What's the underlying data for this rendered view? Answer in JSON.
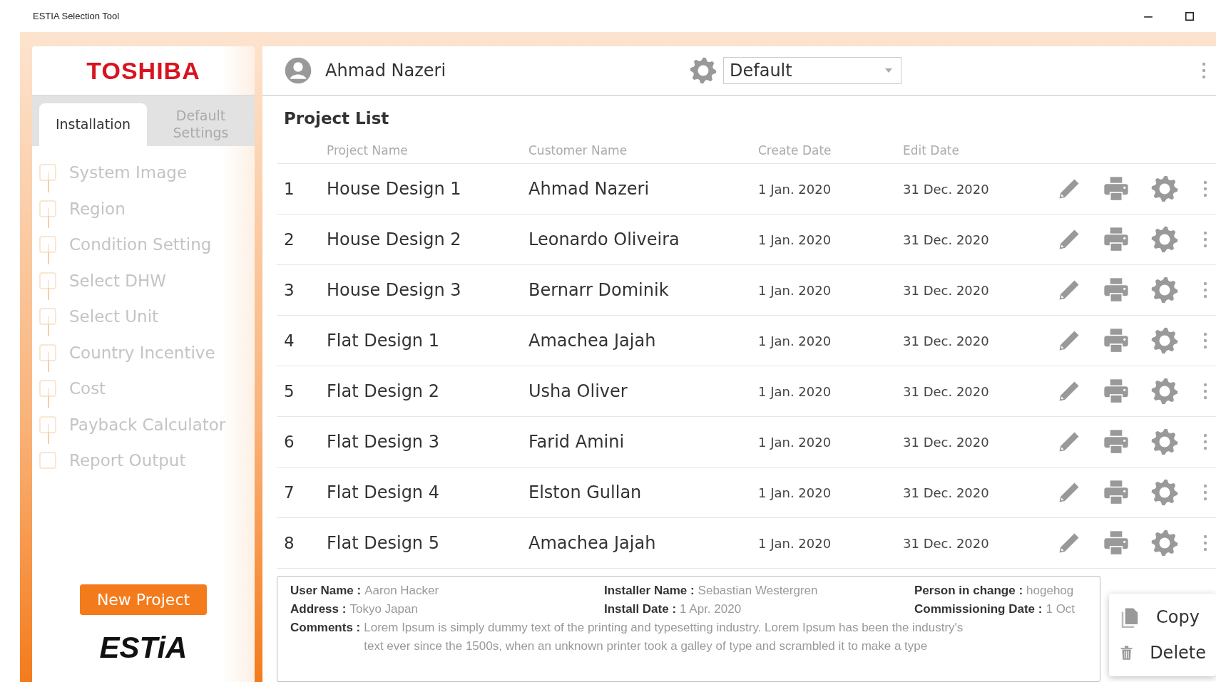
{
  "window": {
    "title": "ESTIA Selection Tool"
  },
  "sidebar": {
    "brand": "TOSHIBA",
    "tabs": [
      {
        "label": "Installation",
        "selected": true
      },
      {
        "label": "Default Settings",
        "selected": false
      }
    ],
    "steps": [
      {
        "label": "System Image",
        "checked": false,
        "disabled": true
      },
      {
        "label": "Region",
        "checked": false,
        "disabled": true
      },
      {
        "label": "Condition Setting",
        "checked": false,
        "disabled": true
      },
      {
        "label": "Select DHW",
        "checked": false,
        "disabled": true
      },
      {
        "label": "Select Unit",
        "checked": false,
        "disabled": true
      },
      {
        "label": "Country Incentive",
        "checked": false,
        "disabled": true
      },
      {
        "label": "Cost",
        "checked": false,
        "disabled": true
      },
      {
        "label": "Payback Calculator",
        "checked": false,
        "disabled": true
      },
      {
        "label": "Report Output",
        "checked": false,
        "disabled": true
      }
    ],
    "new_project_button": "New Project",
    "product_logo": "ESTiA"
  },
  "header": {
    "user_name": "Ahmad Nazeri",
    "profile_select": {
      "value": "Default"
    }
  },
  "project_list": {
    "title": "Project List",
    "columns": [
      "Project Name",
      "Customer Name",
      "Create Date",
      "Edit Date"
    ],
    "rows": [
      {
        "number": "1",
        "project": "House Design 1",
        "customer": "Ahmad Nazeri",
        "created": "1 Jan. 2020",
        "edited": "31 Dec. 2020"
      },
      {
        "number": "2",
        "project": "House Design 2",
        "customer": "Leonardo Oliveira",
        "created": "1 Jan. 2020",
        "edited": "31 Dec. 2020"
      },
      {
        "number": "3",
        "project": "House Design 3",
        "customer": "Bernarr Dominik",
        "created": "1 Jan. 2020",
        "edited": "31 Dec. 2020"
      },
      {
        "number": "4",
        "project": "Flat Design 1",
        "customer": "Amachea Jajah",
        "created": "1 Jan. 2020",
        "edited": "31 Dec. 2020"
      },
      {
        "number": "5",
        "project": "Flat Design 2",
        "customer": "Usha Oliver",
        "created": "1 Jan. 2020",
        "edited": "31 Dec. 2020"
      },
      {
        "number": "6",
        "project": "Flat Design 3",
        "customer": "Farid Amini",
        "created": "1 Jan. 2020",
        "edited": "31 Dec. 2020"
      },
      {
        "number": "7",
        "project": "Flat Design 4",
        "customer": "Elston Gullan",
        "created": "1 Jan. 2020",
        "edited": "31 Dec. 2020"
      },
      {
        "number": "8",
        "project": "Flat Design 5",
        "customer": "Amachea Jajah",
        "created": "1 Jan. 2020",
        "edited": "31 Dec. 2020"
      }
    ]
  },
  "details": {
    "fields": [
      {
        "label": "User Name :",
        "value": "Aaron Hacker"
      },
      {
        "label": "Installer Name :",
        "value": "Sebastian Westergren"
      },
      {
        "label": "Person in change :",
        "value": "hogehog"
      },
      {
        "label": "Address :",
        "value": "Tokyo Japan"
      },
      {
        "label": "Install Date :",
        "value": "1 Apr. 2020"
      },
      {
        "label": "Commissioning Date :",
        "value": "1 Oct"
      }
    ],
    "comments": {
      "label": "Comments :",
      "lines": [
        "Lorem Ipsum is simply dummy text of the printing and typesetting industry. Lorem Ipsum has been the industry's",
        "text ever since the 1500s, when an unknown printer took a galley of type and scrambled it to make a type"
      ]
    }
  },
  "context_menu": {
    "items": [
      {
        "kind": "copy",
        "label": "Copy"
      },
      {
        "kind": "delete",
        "label": "Delete"
      }
    ]
  }
}
